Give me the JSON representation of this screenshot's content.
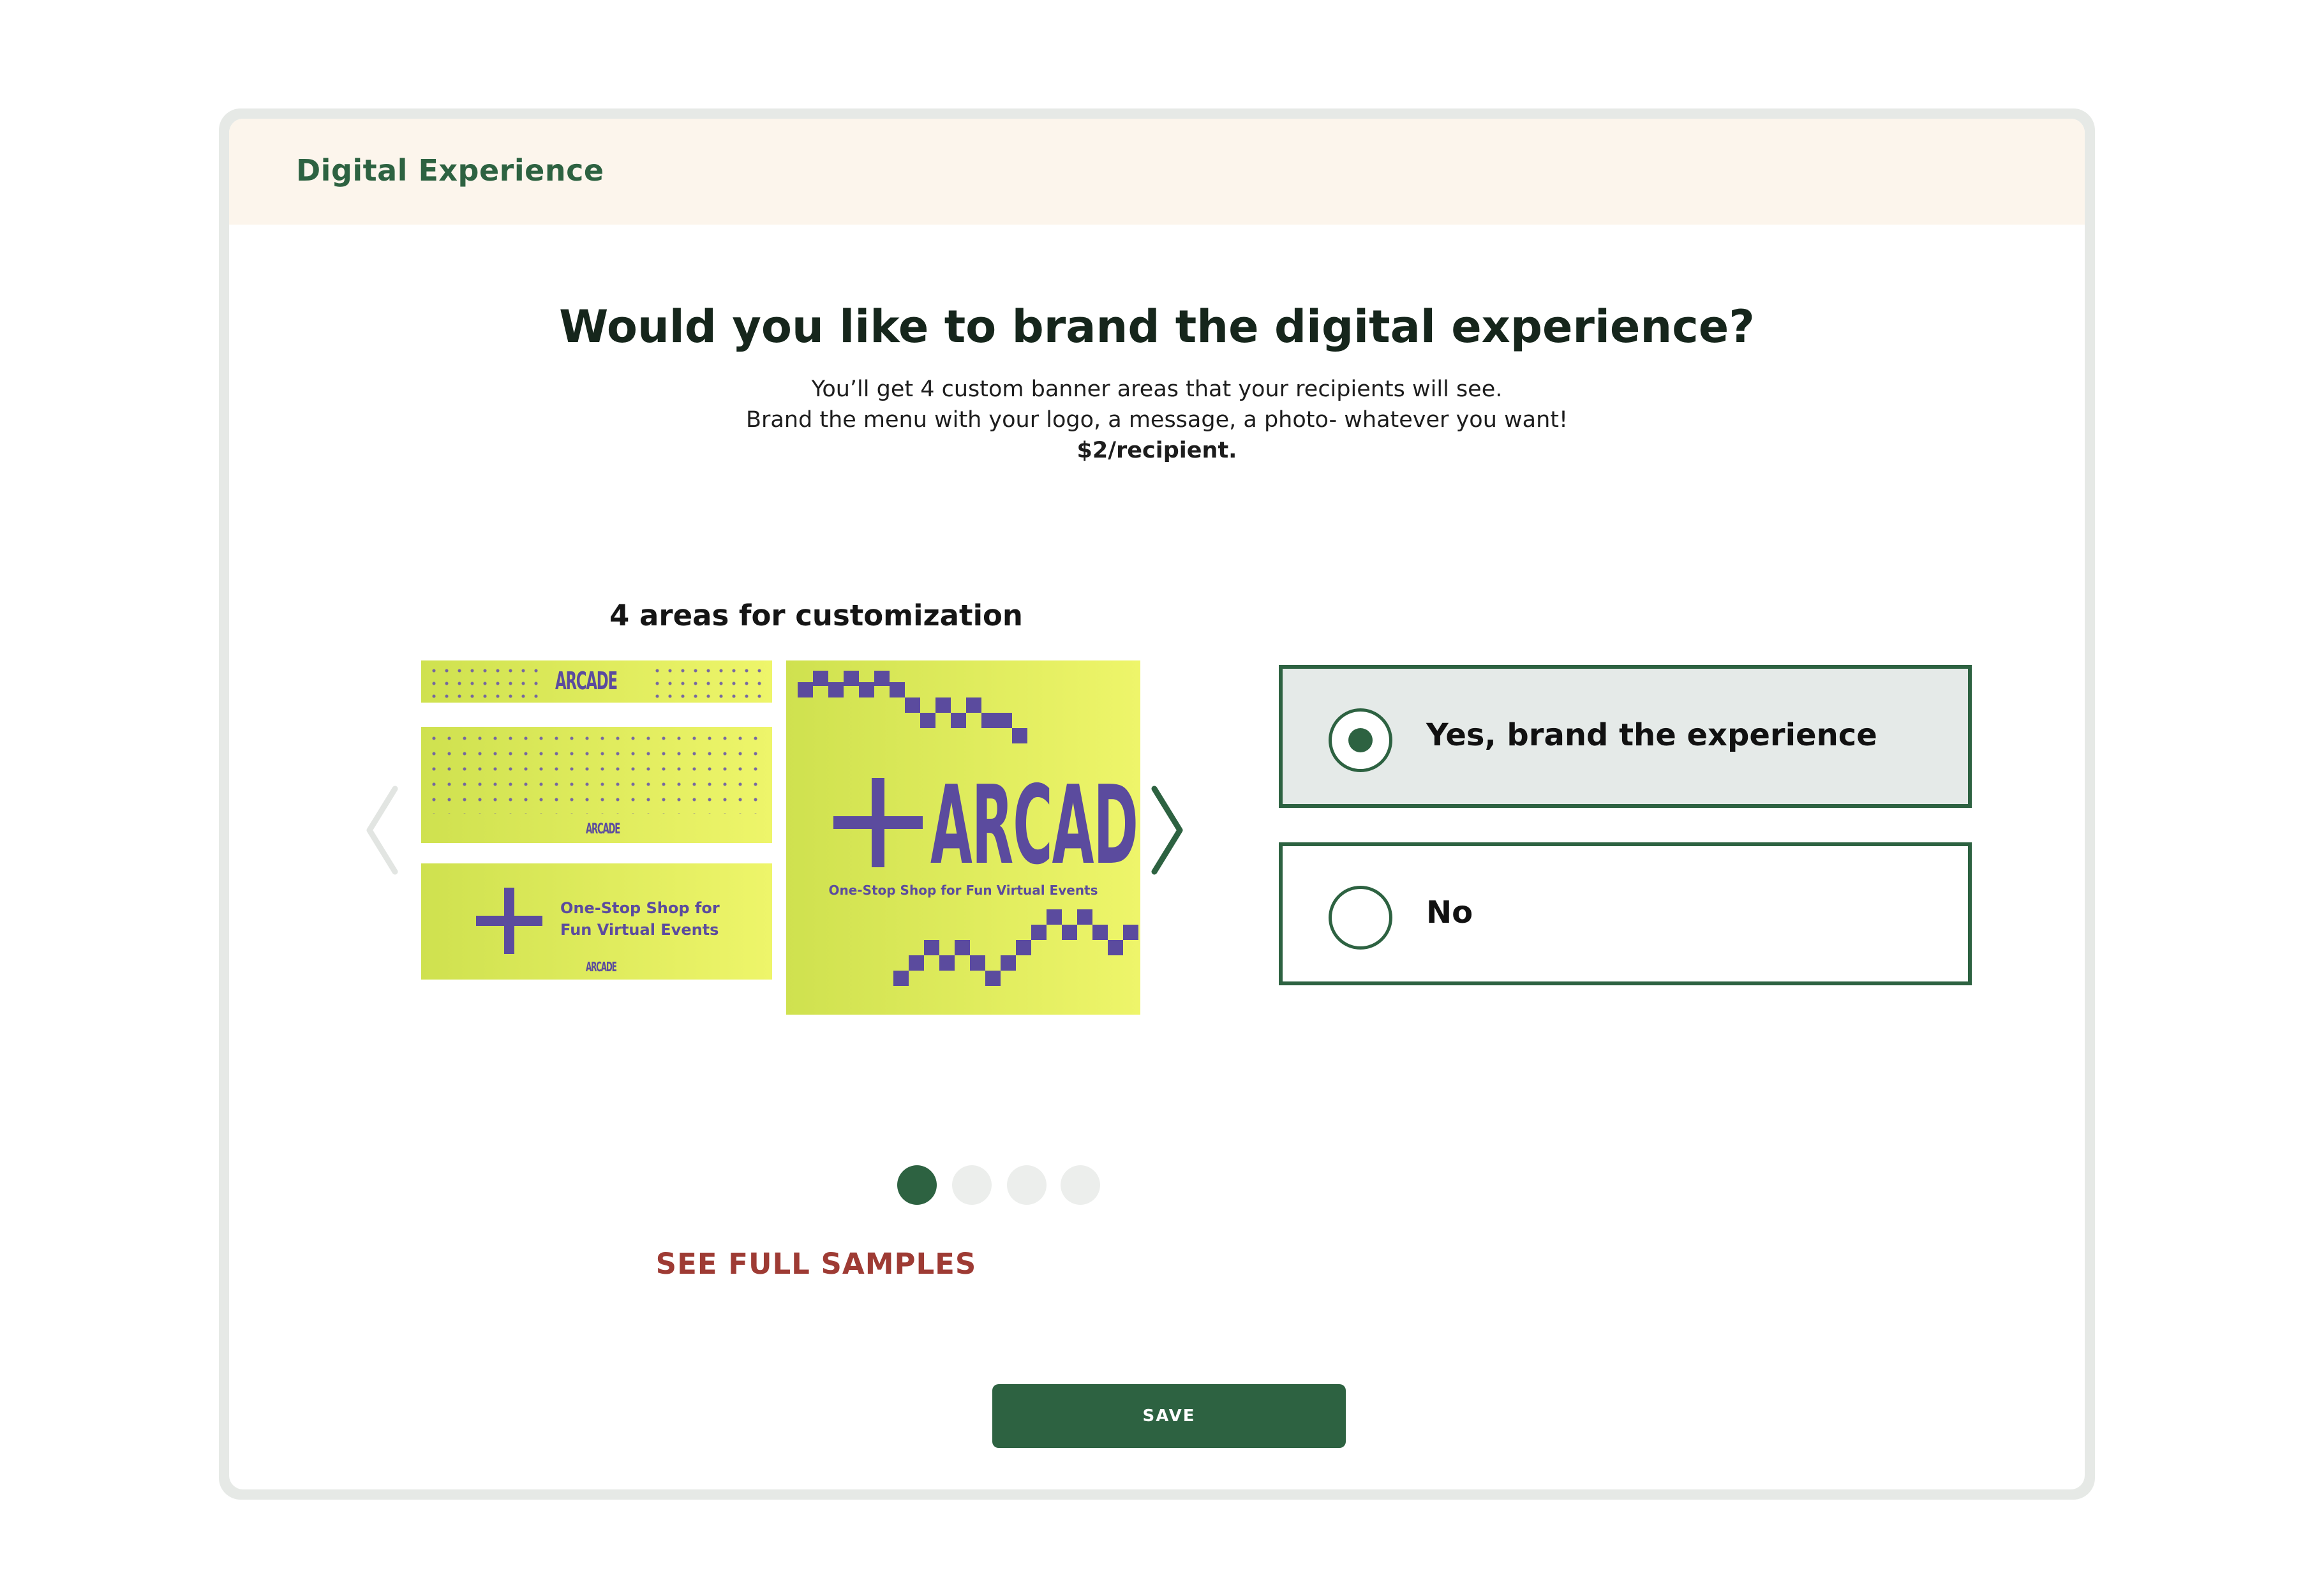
{
  "header": {
    "title": "Digital Experience"
  },
  "question": "Would you like to brand the digital experience?",
  "description": {
    "line1": "You’ll get 4 custom banner areas that your recipients will see.",
    "line2": "Brand the menu with your logo, a message, a photo- whatever you want!",
    "line3": "$2/recipient."
  },
  "preview": {
    "label": "4 areas for customization",
    "banner_brand": "ARCADE",
    "banner_tagline_short_1": "One-Stop Shop for",
    "banner_tagline_short_2": "Fun Virtual Events",
    "banner_tagline_full": "One-Stop Shop for Fun Virtual Events",
    "active_slide": 1,
    "slide_count": 4,
    "see_full_samples": "SEE FULL SAMPLES"
  },
  "options": [
    {
      "label": "Yes, brand the experience",
      "selected": true
    },
    {
      "label": "No",
      "selected": false
    }
  ],
  "footer": {
    "save_label": "SAVE"
  },
  "colors": {
    "brand_green": "#2d6241",
    "header_bg": "#fcf5ec",
    "link_red": "#9e3b34",
    "banner_yellow": "#e3ef5e",
    "banner_purple": "#5b4b9e"
  },
  "icons": {
    "prev": "chevron-left-icon",
    "next": "chevron-right-icon",
    "plus": "plus-icon"
  }
}
